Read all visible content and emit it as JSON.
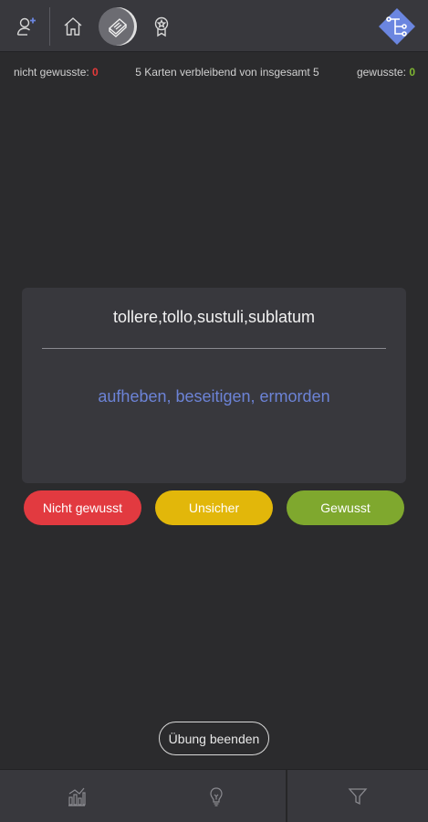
{
  "stats": {
    "unknown_label": "nicht gewusste: ",
    "unknown_count": "0",
    "remaining_text": "5 Karten verbleibend von insgesamt 5",
    "known_label": "gewusste: ",
    "known_count": "0"
  },
  "card": {
    "question": "tollere,tollo,sustuli,sublatum",
    "answer": "aufheben, beseitigen, ermorden"
  },
  "buttons": {
    "not_known": "Nicht gewusst",
    "unsure": "Unsicher",
    "known": "Gewusst",
    "end": "Übung beenden"
  },
  "colors": {
    "red": "#e23a40",
    "yellow": "#e2b70a",
    "green": "#7fa82e",
    "answer_blue": "#6c83d6",
    "logo_blue": "#6b86e0"
  },
  "icons": {
    "topbar": [
      "user-plus-icon",
      "home-icon",
      "book-icon",
      "award-icon",
      "logo-icon"
    ],
    "bottombar": [
      "statistics-icon",
      "lightbulb-icon",
      "filter-icon"
    ]
  }
}
